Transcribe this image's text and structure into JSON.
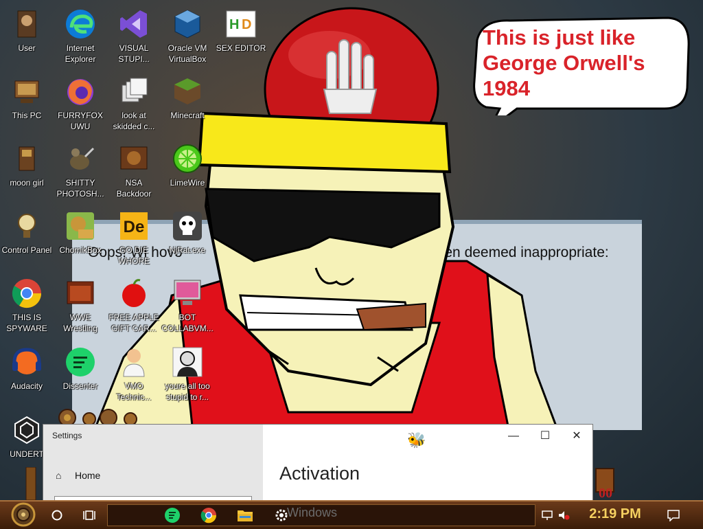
{
  "desktop_icons": [
    {
      "label": "User",
      "icon": "user-icon"
    },
    {
      "label": "Internet Explorer",
      "icon": "edge-icon"
    },
    {
      "label": "VISUAL STUPI...",
      "icon": "visual-studio-icon"
    },
    {
      "label": "Oracle VM VirtualBox",
      "icon": "virtualbox-icon"
    },
    {
      "label": "SEX EDITOR",
      "icon": "hex-editor-icon"
    },
    {
      "label": "This PC",
      "icon": "computer-icon"
    },
    {
      "label": "FURRYFOX UWU",
      "icon": "firefox-icon"
    },
    {
      "label": "look at skidded c...",
      "icon": "copies-icon"
    },
    {
      "label": "Minecraft",
      "icon": "minecraft-icon"
    },
    {
      "label": "moon girl",
      "icon": "moon-girl-icon"
    },
    {
      "label": "SHITTY PHOTOSH...",
      "icon": "gimp-icon"
    },
    {
      "label": "NSA Backdoor",
      "icon": "nsa-icon"
    },
    {
      "label": "LimeWire",
      "icon": "limewire-icon"
    },
    {
      "label": "Control Panel",
      "icon": "control-panel-icon"
    },
    {
      "label": "ChomikBox",
      "icon": "chomikbox-icon"
    },
    {
      "label": "GO DIE WHORE",
      "icon": "de-icon"
    },
    {
      "label": "NjRat.exe",
      "icon": "skull-icon"
    },
    {
      "label": "THIS IS SPYWARE",
      "icon": "chrome-icon"
    },
    {
      "label": "WWE Wrestling",
      "icon": "wrestling-icon"
    },
    {
      "label": "FREE APPLE GIFT CAR...",
      "icon": "apple-icon"
    },
    {
      "label": "BOT COLLABVM...",
      "icon": "monitor-icon"
    },
    {
      "label": "Audacity",
      "icon": "audacity-icon"
    },
    {
      "label": "Dissenter",
      "icon": "dissenter-icon"
    },
    {
      "label": "VMO Technic...",
      "icon": "technician-icon"
    },
    {
      "label": "youre all too stupid to r...",
      "icon": "portrait-icon"
    },
    {
      "label": "UNDERT",
      "icon": "unity-icon"
    }
  ],
  "meme": {
    "speech_bubble": [
      "This is just like",
      "George Orwell's",
      "1984"
    ]
  },
  "background_window": {
    "text_left": "Oops! Wi hovo",
    "text_right": "as been deemed inappropriate:"
  },
  "settings_window": {
    "title": "Settings",
    "home_label": "Home",
    "heading": "Activation",
    "minimize": "—",
    "maximize": "☐",
    "close": "✕"
  },
  "taskbar": {
    "behind_text": "Windows",
    "clock": "2:19 PM"
  },
  "colors": {
    "bubble_text": "#d9232a",
    "clock": "#f5d060",
    "taskbar": "#4a250c"
  }
}
